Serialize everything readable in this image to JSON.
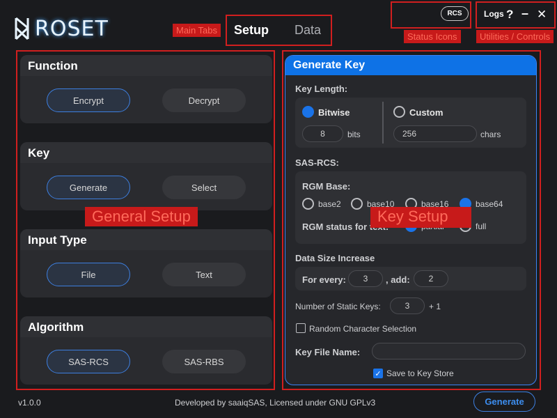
{
  "app": {
    "logo_text": "ROSET"
  },
  "tabs": {
    "setup": "Setup",
    "data": "Data"
  },
  "status": {
    "rcs": "RCS"
  },
  "utilities": {
    "logs": "Logs",
    "help": "?",
    "minimize": "–",
    "close": "✕"
  },
  "annotations": {
    "main_tabs": "Main Tabs",
    "status_icons": "Status Icons",
    "utilities": "Utilities / Controls",
    "general_setup": "General Setup",
    "key_setup": "Key Setup"
  },
  "left": {
    "function": {
      "title": "Function",
      "opt1": "Encrypt",
      "opt2": "Decrypt",
      "selected": "Encrypt"
    },
    "key": {
      "title": "Key",
      "opt1": "Generate",
      "opt2": "Select",
      "selected": "Generate"
    },
    "input_type": {
      "title": "Input Type",
      "opt1": "File",
      "opt2": "Text",
      "selected": "File"
    },
    "algorithm": {
      "title": "Algorithm",
      "opt1": "SAS-RCS",
      "opt2": "SAS-RBS",
      "selected": "SAS-RCS"
    }
  },
  "right": {
    "title": "Generate Key",
    "key_length": {
      "label": "Key Length:",
      "bitwise": "Bitwise",
      "bitwise_value": "8",
      "bitwise_unit": "bits",
      "custom": "Custom",
      "custom_value": "256",
      "custom_unit": "chars",
      "selected": "Bitwise"
    },
    "sas_rcs": {
      "label": "SAS-RCS:",
      "rgm_base_label": "RGM Base:",
      "bases": [
        "base2",
        "base10",
        "base16",
        "base64"
      ],
      "base_selected": "base64",
      "rgm_status_label": "RGM status for text:",
      "status_opts": [
        "partial",
        "full"
      ],
      "status_selected": "partial"
    },
    "data_size": {
      "label": "Data Size Increase",
      "for_every": "For every:",
      "for_every_value": "3",
      "add": ", add:",
      "add_value": "2"
    },
    "static_keys": {
      "label": "Number of Static Keys:",
      "value": "3",
      "suffix": "+ 1"
    },
    "random_char": {
      "label": "Random Character Selection",
      "checked": false
    },
    "key_file": {
      "label": "Key File Name:",
      "value": ""
    },
    "save_store": {
      "label": "Save to Key Store",
      "checked": true
    }
  },
  "footer": {
    "version": "v1.0.0",
    "credits": "Developed by saaiqSAS, Licensed under GNU GPLv3",
    "generate": "Generate"
  },
  "colors": {
    "accent": "#1a73e8",
    "annotation": "#d11f1f"
  }
}
